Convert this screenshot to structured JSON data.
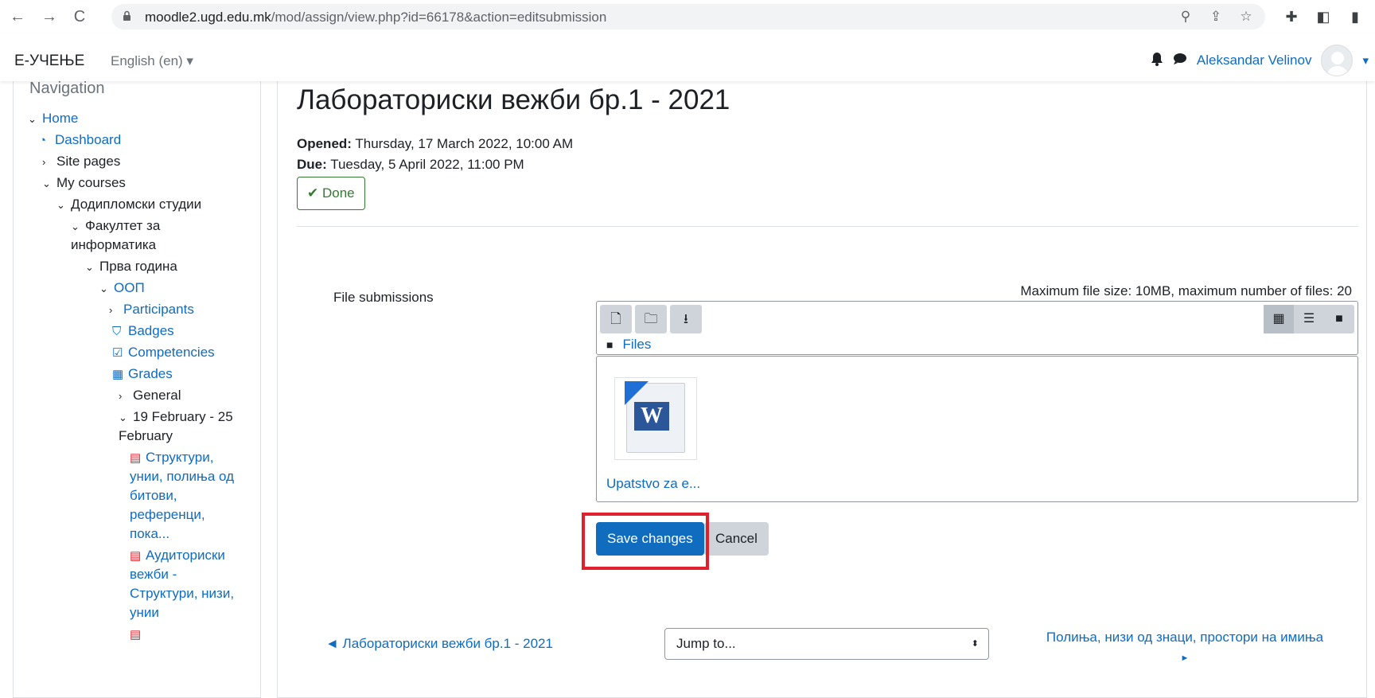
{
  "browser": {
    "url_host": "moodle2.ugd.edu.mk",
    "url_path": "/mod/assign/view.php?id=66178&action=editsubmission",
    "back": "←",
    "forward": "→",
    "reload": "C"
  },
  "header": {
    "brand": "Е-УЧЕЊЕ",
    "language": "English (en) ▾",
    "user_name": "Aleksandar Velinov",
    "bell": "🔔",
    "chat": "💬",
    "menu_caret": "▾"
  },
  "navigation": {
    "title": "Navigation",
    "items": [
      {
        "label": "Home",
        "caret": "⌄"
      },
      {
        "label": "Dashboard",
        "icon": "dashboard-icon"
      },
      {
        "label": "Site pages",
        "caret": "›"
      },
      {
        "label": "My courses",
        "caret": "⌄"
      },
      {
        "label": "Додипломски студии",
        "caret": "⌄"
      },
      {
        "label": "Факултет за",
        "caret": "⌄"
      },
      {
        "label": "информатика"
      },
      {
        "label": "Прва година",
        "caret": "⌄"
      },
      {
        "label": "ООП",
        "caret": "⌄"
      },
      {
        "label": "Participants",
        "caret": "›"
      },
      {
        "label": "Badges",
        "icon": "badge-icon"
      },
      {
        "label": "Competencies",
        "icon": "competencies-icon"
      },
      {
        "label": "Grades",
        "icon": "grades-icon"
      },
      {
        "label": "General",
        "caret": "›"
      },
      {
        "label": "19 February - 25",
        "caret": "⌄"
      },
      {
        "label": "February"
      },
      {
        "label": "Структури,"
      },
      {
        "label": "унии, полиња од"
      },
      {
        "label": "битови,"
      },
      {
        "label": "референци,"
      },
      {
        "label": "пока..."
      },
      {
        "label": "Аудиториски"
      },
      {
        "label": "вежби -"
      },
      {
        "label": "Структури, низи,"
      },
      {
        "label": "унии"
      }
    ]
  },
  "assignment": {
    "title": "Лабораториски вежби бр.1 - 2021",
    "opened_label": "Opened:",
    "opened_value": "Thursday, 17 March 2022, 10:00 AM",
    "due_label": "Due:",
    "due_value": "Tuesday, 5 April 2022, 11:00 PM",
    "done_label": "✔ Done"
  },
  "submission": {
    "label": "File submissions",
    "max_info": "Maximum file size: 10MB, maximum number of files: 20",
    "path_label": "Files",
    "file_name": "Upatstvo za e...",
    "save_label": "Save changes",
    "cancel_label": "Cancel"
  },
  "footer_nav": {
    "prev_link": "◄ Лабораториски вежби бр.1 - 2021",
    "jump_placeholder": "Jump to...",
    "jump_arrows": "⬍",
    "next_link_line1": "Полиња, низи од знаци, простори на имиња",
    "next_link_line2": "►"
  },
  "colors": {
    "link": "#0f6cbf",
    "primary": "#0f6cbf",
    "success": "#357a32",
    "highlight": "#e0202b"
  }
}
